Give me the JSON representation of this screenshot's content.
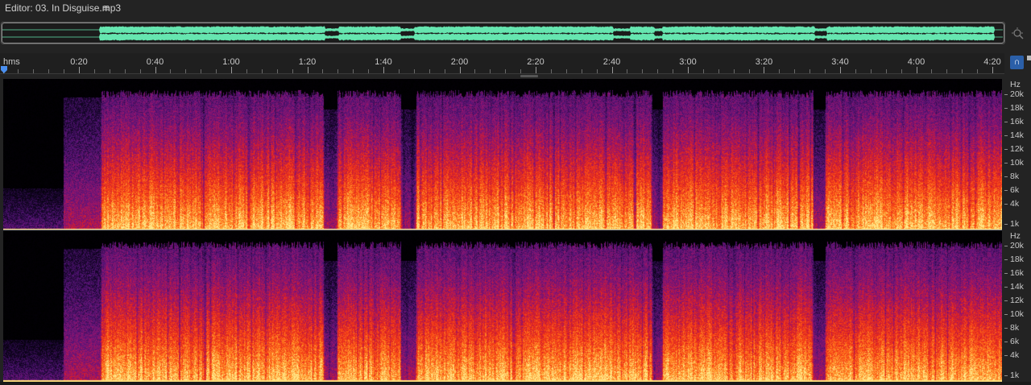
{
  "editor": {
    "title": "Editor: 03. In Disguise.mp3",
    "menu_icon": "hamburger-menu-icon",
    "menu_glyph": "≡"
  },
  "overview": {
    "waveform_color": "#66e6b0",
    "zoom_icon": "zoom-navigator-icon"
  },
  "timeline": {
    "unit_label": "hms",
    "labels": [
      "0:20",
      "0:40",
      "1:00",
      "1:20",
      "1:40",
      "2:00",
      "2:20",
      "2:40",
      "3:00",
      "3:20",
      "3:40",
      "4:00",
      "4:20"
    ],
    "label_seconds": [
      20,
      40,
      60,
      80,
      100,
      120,
      140,
      160,
      180,
      200,
      220,
      240,
      260
    ],
    "playhead_seconds": 0,
    "snap_icon": "magnet-snap-icon",
    "snap_glyph": "∩"
  },
  "spectral": {
    "unit": "Hz",
    "labels": [
      "20k",
      "18k",
      "16k",
      "14k",
      "12k",
      "10k",
      "8k",
      "6k",
      "4k",
      "1k"
    ],
    "label_hz": [
      20000,
      18000,
      16000,
      14000,
      12000,
      10000,
      8000,
      6000,
      4000,
      1000
    ]
  },
  "colors": {
    "background": "#232323",
    "accent_blue": "#2b5fa8",
    "spectrogram_low": "#000000",
    "spectrogram_mid": "#7a1fa0",
    "spectrogram_high": "#ff3a10",
    "spectrogram_peak": "#ffe28a"
  }
}
